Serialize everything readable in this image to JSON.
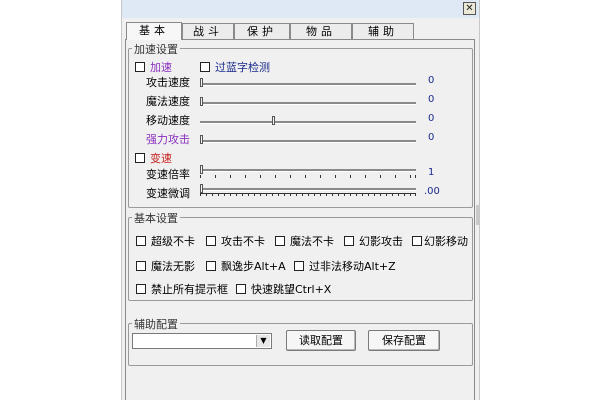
{
  "window": {
    "close_glyph": "✕"
  },
  "tabs": [
    {
      "label": "基本",
      "active": true
    },
    {
      "label": "战斗",
      "active": false
    },
    {
      "label": "保护",
      "active": false
    },
    {
      "label": "物品",
      "active": false
    },
    {
      "label": "辅助",
      "active": false
    }
  ],
  "accel": {
    "legend": "加速设置",
    "accel_checkbox": {
      "label": "加速",
      "checked": false
    },
    "bypass_checkbox": {
      "label": "过蓝字检测",
      "checked": false
    },
    "sliders": [
      {
        "label": "攻击速度",
        "value": "0",
        "fraction": 0.0
      },
      {
        "label": "魔法速度",
        "value": "0",
        "fraction": 0.0
      },
      {
        "label": "移动速度",
        "value": "0",
        "fraction": 0.34
      },
      {
        "label": "强力攻击",
        "value": "0",
        "fraction": 0.0
      }
    ],
    "speedchange_checkbox": {
      "label": "变速",
      "checked": false
    },
    "rate": {
      "label": "变速倍率",
      "value": "1",
      "fraction": 0.0
    },
    "fine": {
      "label": "变速微调",
      "value": ".00",
      "fraction": 0.0
    }
  },
  "basic": {
    "legend": "基本设置",
    "options": [
      {
        "label": "超级不卡",
        "checked": false
      },
      {
        "label": "攻击不卡",
        "checked": false
      },
      {
        "label": "魔法不卡",
        "checked": false
      },
      {
        "label": "幻影攻击",
        "checked": false
      },
      {
        "label": "幻影移动",
        "checked": false
      },
      {
        "label": "魔法无影",
        "checked": false
      },
      {
        "label": "飘逸步Alt+A",
        "checked": false
      },
      {
        "label": "过非法移动Alt+Z",
        "checked": false
      },
      {
        "label": "禁止所有提示框",
        "checked": false
      },
      {
        "label": "快速跳望Ctrl+X",
        "checked": false
      }
    ]
  },
  "assist": {
    "legend": "辅助配置",
    "select_value": "",
    "arrow_glyph": "▼",
    "read_button": "读取配置",
    "save_button": "保存配置"
  },
  "icons": {
    "close": "close-icon",
    "dropdown": "chevron-down-icon"
  }
}
